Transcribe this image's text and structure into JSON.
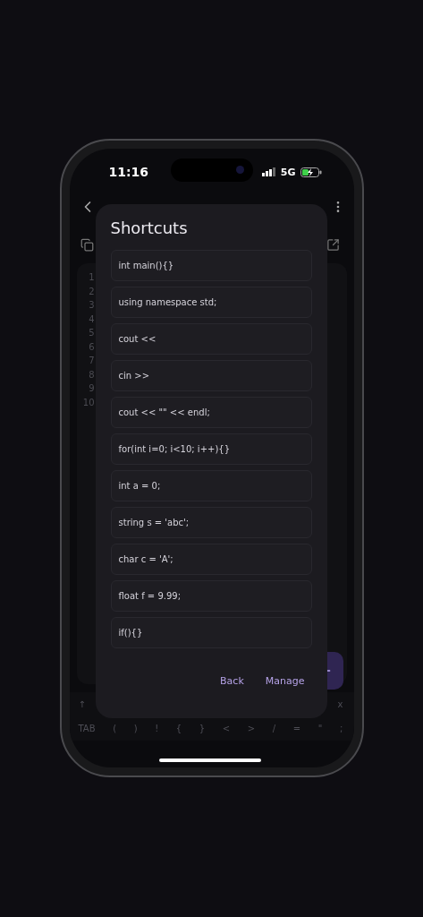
{
  "status_bar": {
    "time": "11:16",
    "network": "5G"
  },
  "editor": {
    "line_numbers": [
      "1",
      "2",
      "3",
      "4",
      "5",
      "6",
      "7",
      "8",
      "9",
      "10"
    ]
  },
  "keyboard": {
    "row_1": [
      "↑",
      "x"
    ],
    "row_2": [
      "TAB",
      "(",
      ")",
      "!",
      "{",
      "}",
      "<",
      ">",
      "/",
      "=",
      "\"",
      ";"
    ]
  },
  "dialog": {
    "title": "Shortcuts",
    "shortcuts": [
      "int main(){}",
      "using namespace std;",
      "cout <<",
      "cin >>",
      "cout << \"\" << endl;",
      "for(int i=0; i<10; i++){}",
      "int a = 0;",
      "string s = 'abc';",
      "char c = 'A';",
      "float f = 9.99;",
      "if(){}"
    ],
    "buttons": [
      "Back",
      "Manage"
    ]
  }
}
